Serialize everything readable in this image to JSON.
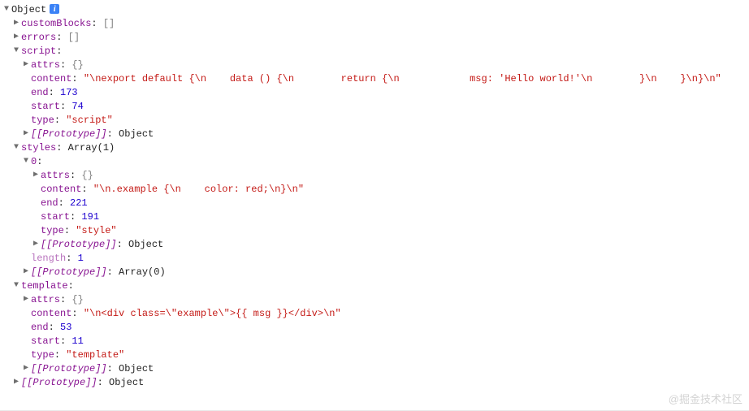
{
  "rootLabel": "Object",
  "watermark": "@掘金技术社区",
  "icons": {
    "down": "▼",
    "right": "▶",
    "info": "i"
  },
  "object": {
    "customBlocks": {
      "key": "customBlocks",
      "repr": "[]"
    },
    "errors": {
      "key": "errors",
      "repr": "[]"
    },
    "script": {
      "key": "script",
      "attrs": {
        "key": "attrs",
        "repr": "{}"
      },
      "content": {
        "key": "content",
        "value": "\"\\nexport default {\\n    data () {\\n        return {\\n            msg: 'Hello world!'\\n        }\\n    }\\n}\\n\""
      },
      "end": {
        "key": "end",
        "value": "173"
      },
      "start": {
        "key": "start",
        "value": "74"
      },
      "type": {
        "key": "type",
        "value": "\"script\""
      },
      "proto": {
        "key": "[[Prototype]]",
        "repr": "Object"
      }
    },
    "styles": {
      "key": "styles",
      "header": "Array(1)",
      "item0": {
        "key": "0",
        "attrs": {
          "key": "attrs",
          "repr": "{}"
        },
        "content": {
          "key": "content",
          "value": "\"\\n.example {\\n    color: red;\\n}\\n\""
        },
        "end": {
          "key": "end",
          "value": "221"
        },
        "start": {
          "key": "start",
          "value": "191"
        },
        "type": {
          "key": "type",
          "value": "\"style\""
        },
        "proto": {
          "key": "[[Prototype]]",
          "repr": "Object"
        }
      },
      "length": {
        "key": "length",
        "value": "1"
      },
      "proto": {
        "key": "[[Prototype]]",
        "repr": "Array(0)"
      }
    },
    "template": {
      "key": "template",
      "attrs": {
        "key": "attrs",
        "repr": "{}"
      },
      "content": {
        "key": "content",
        "value": "\"\\n<div class=\\\"example\\\">{{ msg }}</div>\\n\""
      },
      "end": {
        "key": "end",
        "value": "53"
      },
      "start": {
        "key": "start",
        "value": "11"
      },
      "type": {
        "key": "type",
        "value": "\"template\""
      },
      "proto": {
        "key": "[[Prototype]]",
        "repr": "Object"
      }
    },
    "proto": {
      "key": "[[Prototype]]",
      "repr": "Object"
    }
  }
}
